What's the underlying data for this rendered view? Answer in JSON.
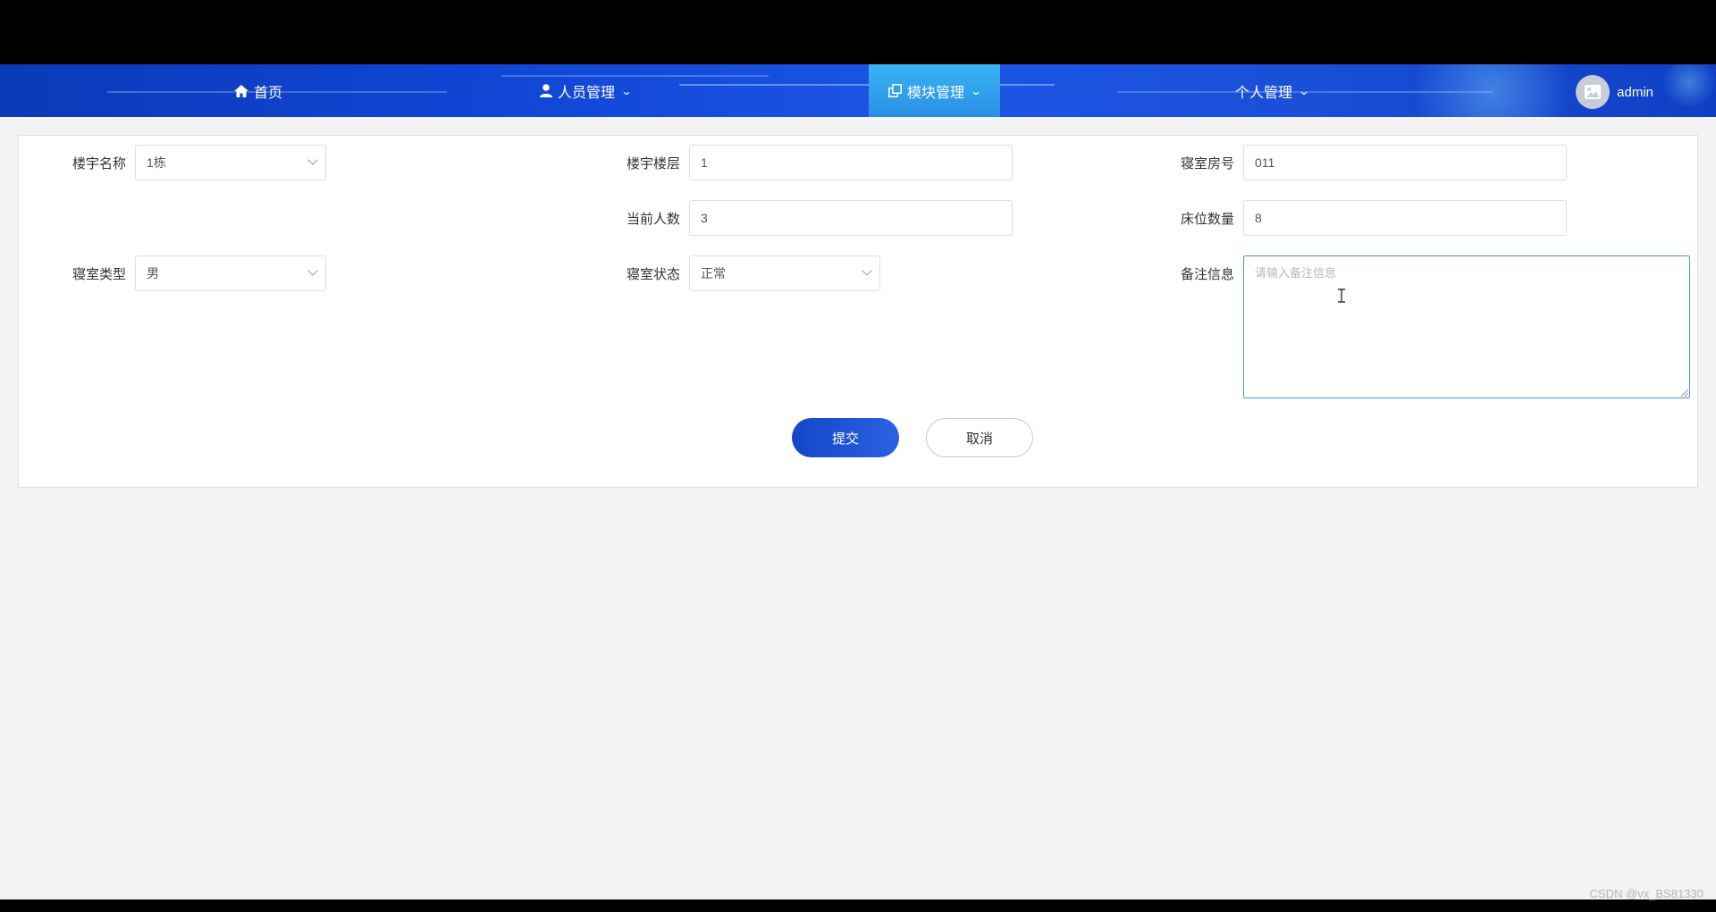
{
  "nav": {
    "home": "首页",
    "personnel": "人员管理",
    "modules": "模块管理",
    "personal": "个人管理",
    "username": "admin"
  },
  "form": {
    "building_name_label": "楼宇名称",
    "building_name_value": "1栋",
    "building_floor_label": "楼宇楼层",
    "building_floor_value": "1",
    "room_no_label": "寝室房号",
    "room_no_value": "011",
    "current_count_label": "当前人数",
    "current_count_value": "3",
    "bed_count_label": "床位数量",
    "bed_count_value": "8",
    "room_type_label": "寝室类型",
    "room_type_value": "男",
    "room_status_label": "寝室状态",
    "room_status_value": "正常",
    "remarks_label": "备注信息",
    "remarks_placeholder": "请输入备注信息",
    "submit": "提交",
    "cancel": "取消"
  },
  "watermark": "CSDN @vx_BS81330",
  "colors": {
    "nav_blue": "#1146d6",
    "nav_active": "#2a8fe6",
    "primary": "#1446c9"
  }
}
